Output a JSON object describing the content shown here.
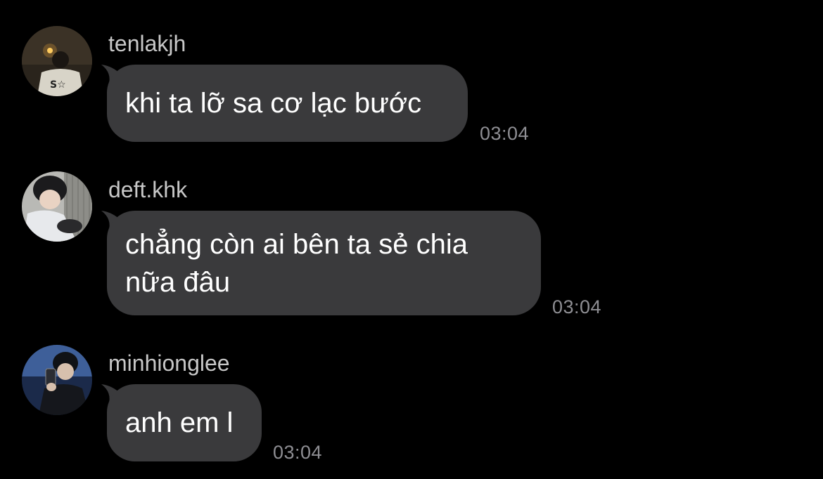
{
  "colors": {
    "background": "#000000",
    "bubble": "#3a3a3c",
    "username": "#c7c7c7",
    "timestamp": "#8e8e93",
    "message_text": "#ffffff"
  },
  "messages": [
    {
      "username": "tenlakjh",
      "avatar_icon": "user-avatar-photo",
      "lines": [
        "khi ta lỡ sa cơ lạc bước"
      ],
      "time": "03:04"
    },
    {
      "username": "deft.khk",
      "avatar_icon": "user-avatar-photo",
      "lines": [
        "chẳng còn ai bên ta sẻ chia",
        "nữa đâu"
      ],
      "time": "03:04"
    },
    {
      "username": "minhionglee",
      "avatar_icon": "user-avatar-photo",
      "lines": [
        "anh em l"
      ],
      "time": "03:04"
    }
  ]
}
